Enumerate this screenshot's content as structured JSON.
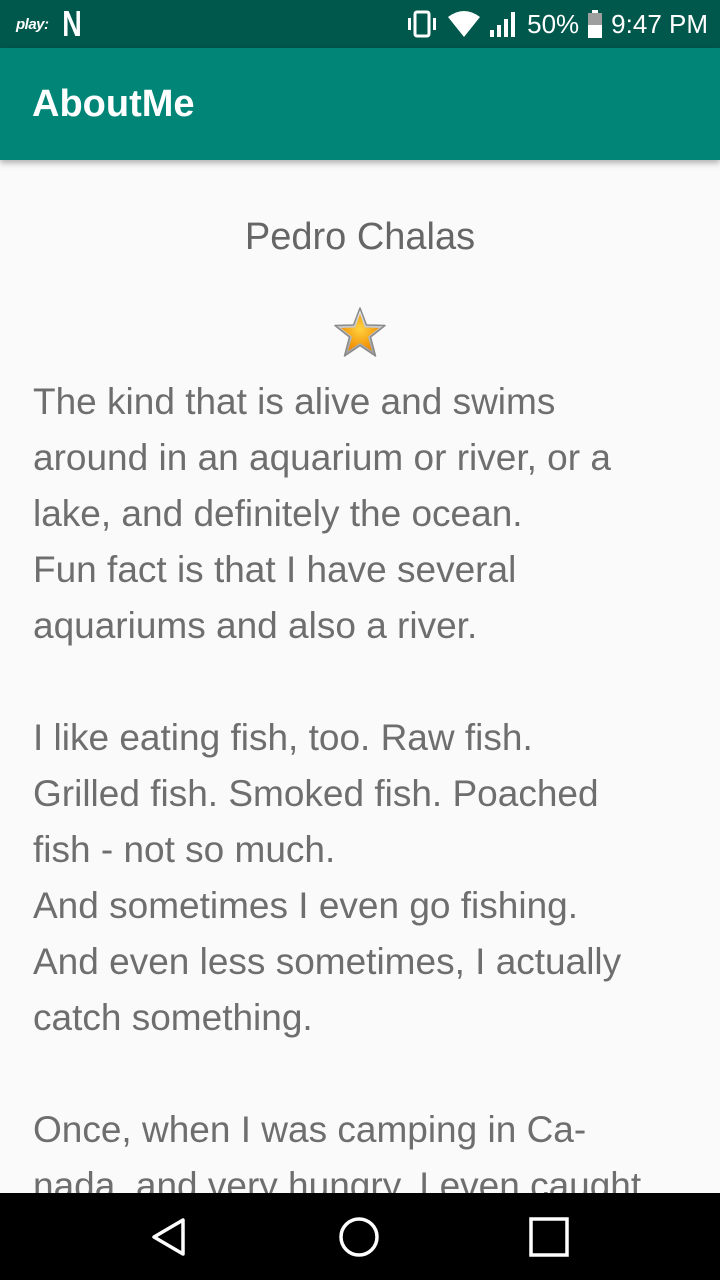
{
  "status_bar": {
    "play_label": "play:",
    "notification_letter": "N",
    "battery": "50%",
    "time": "9:47 PM",
    "icons": [
      "vibrate-icon",
      "wifi-icon",
      "signal-icon",
      "battery-icon"
    ]
  },
  "app_bar": {
    "title": "AboutMe"
  },
  "profile": {
    "name": "Pedro Chalas",
    "star_icon": "star-icon"
  },
  "bio": {
    "text": "The kind that is alive and swims\naround in an aquarium or river, or a\nlake, and definitely the ocean.\nFun fact is that I have several\naquariums and also a river.\n\nI like eating fish, too. Raw fish.\nGrilled fish. Smoked fish. Poached\nfish - not so much.\nAnd sometimes I even go fishing.\nAnd even less sometimes, I actually\ncatch something.\n\nOnce, when I was camping in Ca-\nnada, and very hungry, I even caught"
  },
  "nav_bar": {
    "icons": [
      "back-icon",
      "home-icon",
      "recents-icon"
    ]
  },
  "colors": {
    "status_bar": "#00574b",
    "app_bar": "#008577",
    "background": "#fafafa",
    "text": "#6e6e6e"
  }
}
